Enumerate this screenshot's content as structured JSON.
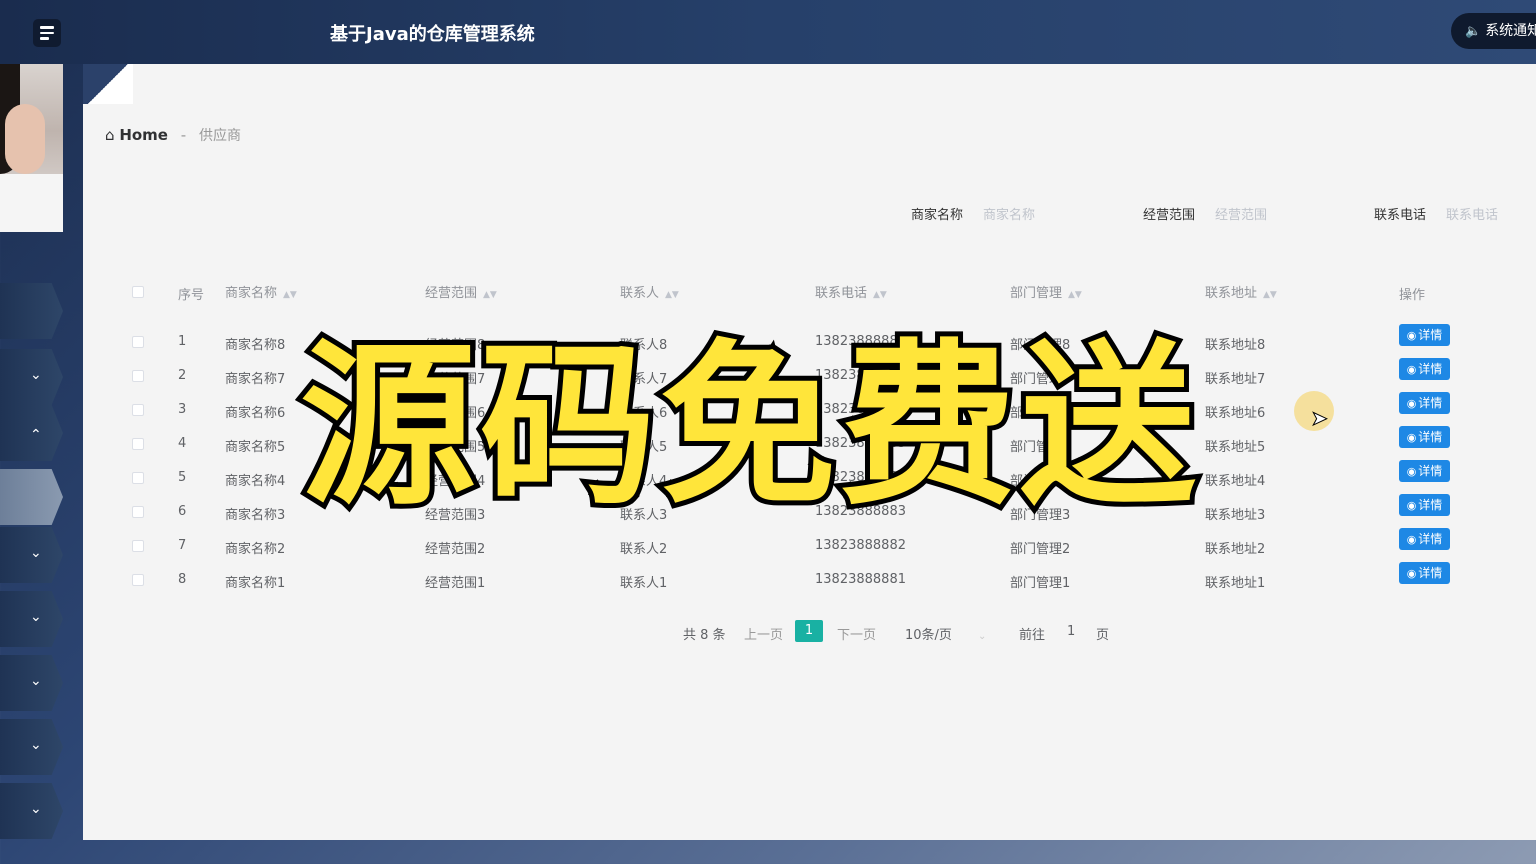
{
  "header": {
    "title": "基于Java的仓库管理系统",
    "notice_label": "系统通知"
  },
  "breadcrumb": {
    "home": "Home",
    "separator": "-",
    "current": "供应商"
  },
  "filters": [
    {
      "label": "商家名称",
      "placeholder": "商家名称"
    },
    {
      "label": "经营范围",
      "placeholder": "经营范围"
    },
    {
      "label": "联系电话",
      "placeholder": "联系电话"
    }
  ],
  "table": {
    "columns": [
      "序号",
      "商家名称",
      "经营范围",
      "联系人",
      "联系电话",
      "部门管理",
      "联系地址",
      "操作"
    ],
    "action_label": "详情",
    "rows": [
      {
        "no": "1",
        "name": "商家名称8",
        "scope": "经营范围8",
        "contact": "联系人8",
        "phone": "13823888888",
        "dept": "部门管理8",
        "address": "联系地址8"
      },
      {
        "no": "2",
        "name": "商家名称7",
        "scope": "经营范围7",
        "contact": "联系人7",
        "phone": "13823888887",
        "dept": "部门管理7",
        "address": "联系地址7"
      },
      {
        "no": "3",
        "name": "商家名称6",
        "scope": "经营范围6",
        "contact": "联系人6",
        "phone": "13823888886",
        "dept": "部门管理6",
        "address": "联系地址6"
      },
      {
        "no": "4",
        "name": "商家名称5",
        "scope": "经营范围5",
        "contact": "联系人5",
        "phone": "13823888885",
        "dept": "部门管理5",
        "address": "联系地址5"
      },
      {
        "no": "5",
        "name": "商家名称4",
        "scope": "经营范围4",
        "contact": "联系人4",
        "phone": "13823888884",
        "dept": "部门管理4",
        "address": "联系地址4"
      },
      {
        "no": "6",
        "name": "商家名称3",
        "scope": "经营范围3",
        "contact": "联系人3",
        "phone": "13823888883",
        "dept": "部门管理3",
        "address": "联系地址3"
      },
      {
        "no": "7",
        "name": "商家名称2",
        "scope": "经营范围2",
        "contact": "联系人2",
        "phone": "13823888882",
        "dept": "部门管理2",
        "address": "联系地址2"
      },
      {
        "no": "8",
        "name": "商家名称1",
        "scope": "经营范围1",
        "contact": "联系人1",
        "phone": "13823888881",
        "dept": "部门管理1",
        "address": "联系地址1"
      }
    ]
  },
  "pagination": {
    "total": "共 8 条",
    "prev": "上一页",
    "current": "1",
    "next": "下一页",
    "page_size": "10条/页",
    "goto_prefix": "前往",
    "goto_value": "1",
    "goto_suffix": "页"
  },
  "overlay_text": "源码免费送",
  "icons": {
    "menu": "menu-icon",
    "speaker": "speaker-icon",
    "home": "home-icon",
    "eye": "eye-icon",
    "chevron": "chevron-icon"
  },
  "colors": {
    "primary_button": "#1e88e5",
    "page_active": "#19b1a3",
    "overlay_fill": "#ffe53a"
  }
}
